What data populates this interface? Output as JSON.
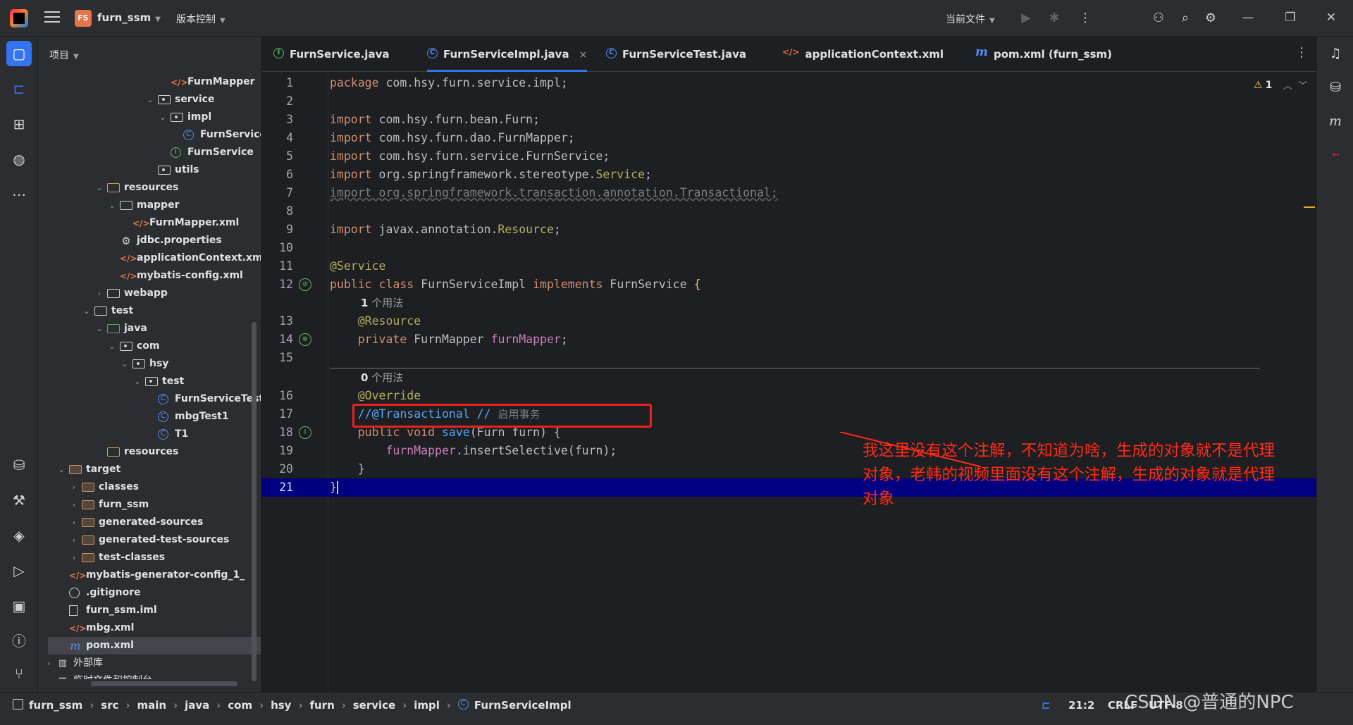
{
  "titlebar": {
    "project_badge": "FS",
    "project_name": "furn_ssm",
    "vcs_label": "版本控制",
    "run_config": "当前文件"
  },
  "project_panel": {
    "header": "项目",
    "tree": [
      {
        "label": "FurnMapper",
        "level": 9,
        "arrow": "",
        "icon": "xml"
      },
      {
        "label": "service",
        "level": 8,
        "arrow": "v",
        "icon": "pkg"
      },
      {
        "label": "impl",
        "level": 9,
        "arrow": "v",
        "icon": "pkg"
      },
      {
        "label": "FurnServiceImpl",
        "level": 10,
        "arrow": "",
        "icon": "cls"
      },
      {
        "label": "FurnService",
        "level": 9,
        "arrow": "",
        "icon": "intf"
      },
      {
        "label": "utils",
        "level": 8,
        "arrow": "",
        "icon": "pkg"
      },
      {
        "label": "resources",
        "level": 4,
        "arrow": "v",
        "icon": "res"
      },
      {
        "label": "mapper",
        "level": 5,
        "arrow": "v",
        "icon": "folder"
      },
      {
        "label": "FurnMapper.xml",
        "level": 6,
        "arrow": "",
        "icon": "xml"
      },
      {
        "label": "jdbc.properties",
        "level": 5,
        "arrow": "",
        "icon": "props"
      },
      {
        "label": "applicationContext.xml",
        "level": 5,
        "arrow": "",
        "icon": "xml"
      },
      {
        "label": "mybatis-config.xml",
        "level": 5,
        "arrow": "",
        "icon": "xml"
      },
      {
        "label": "webapp",
        "level": 4,
        "arrow": ">",
        "icon": "folder"
      },
      {
        "label": "test",
        "level": 3,
        "arrow": "v",
        "icon": "folder"
      },
      {
        "label": "java",
        "level": 4,
        "arrow": "v",
        "icon": "src"
      },
      {
        "label": "com",
        "level": 5,
        "arrow": "v",
        "icon": "pkg"
      },
      {
        "label": "hsy",
        "level": 6,
        "arrow": "v",
        "icon": "pkg"
      },
      {
        "label": "test",
        "level": 7,
        "arrow": "v",
        "icon": "pkg"
      },
      {
        "label": "FurnServiceTest",
        "level": 8,
        "arrow": "",
        "icon": "cls"
      },
      {
        "label": "mbgTest1",
        "level": 8,
        "arrow": "",
        "icon": "cls"
      },
      {
        "label": "T1",
        "level": 8,
        "arrow": "",
        "icon": "cls"
      },
      {
        "label": "resources",
        "level": 4,
        "arrow": "",
        "icon": "res"
      },
      {
        "label": "target",
        "level": 1,
        "arrow": "v",
        "icon": "target"
      },
      {
        "label": "classes",
        "level": 2,
        "arrow": ">",
        "icon": "target"
      },
      {
        "label": "furn_ssm",
        "level": 2,
        "arrow": ">",
        "icon": "target"
      },
      {
        "label": "generated-sources",
        "level": 2,
        "arrow": ">",
        "icon": "target"
      },
      {
        "label": "generated-test-sources",
        "level": 2,
        "arrow": ">",
        "icon": "target"
      },
      {
        "label": "test-classes",
        "level": 2,
        "arrow": ">",
        "icon": "target"
      },
      {
        "label": "mybatis-generator-config_1_",
        "level": 1,
        "arrow": "",
        "icon": "xml"
      },
      {
        "label": ".gitignore",
        "level": 1,
        "arrow": "",
        "icon": "ign"
      },
      {
        "label": "furn_ssm.iml",
        "level": 1,
        "arrow": "",
        "icon": "file"
      },
      {
        "label": "mbg.xml",
        "level": 1,
        "arrow": "",
        "icon": "xml"
      },
      {
        "label": "pom.xml",
        "level": 1,
        "arrow": "",
        "icon": "mvn",
        "selected": true
      },
      {
        "label": "外部库",
        "level": 0,
        "arrow": ">",
        "icon": "lib",
        "plain": true
      },
      {
        "label": "临时文件和控制台",
        "level": 0,
        "arrow": "",
        "icon": "lib",
        "plain": true
      }
    ]
  },
  "tabs": [
    {
      "label": "FurnService.java",
      "icon": "I",
      "kind": "i"
    },
    {
      "label": "FurnServiceImpl.java",
      "icon": "C",
      "kind": "c",
      "active": true,
      "close": "×"
    },
    {
      "label": "FurnServiceTest.java",
      "icon": "C",
      "kind": "c"
    },
    {
      "label": "applicationContext.xml",
      "icon": "</>",
      "kind": "x"
    },
    {
      "label": "pom.xml (furn_ssm)",
      "icon": "m",
      "kind": "m"
    }
  ],
  "editor": {
    "warning_count": "1",
    "hint_usage_1": "1",
    "hint_usage_1_text": " 个用法",
    "hint_usage_0": "0",
    "hint_usage_0_text": " 个用法",
    "line_numbers": [
      "1",
      "2",
      "3",
      "4",
      "5",
      "6",
      "7",
      "8",
      "9",
      "10",
      "11",
      "12",
      "13",
      "14",
      "15",
      "16",
      "17",
      "18",
      "19",
      "20",
      "21"
    ],
    "comment_cn": "启用事务",
    "annotation_note": "我这里没有这个注解，不知道为啥，生成的对象就不是代理对象，老韩的视频里面没有这个注解，生成的对象就是代理对象"
  },
  "statusbar": {
    "breadcrumbs": [
      "furn_ssm",
      "src",
      "main",
      "java",
      "com",
      "hsy",
      "furn",
      "service",
      "impl",
      "FurnServiceImpl"
    ],
    "position": "21:2",
    "line_ending": "CRLF",
    "encoding": "UTF-8",
    "watermark": "CSDN @普通的NPC"
  },
  "colors": {
    "accent": "#3574f0",
    "annotation_red": "#ff2a1a",
    "current_line": "#000080"
  }
}
